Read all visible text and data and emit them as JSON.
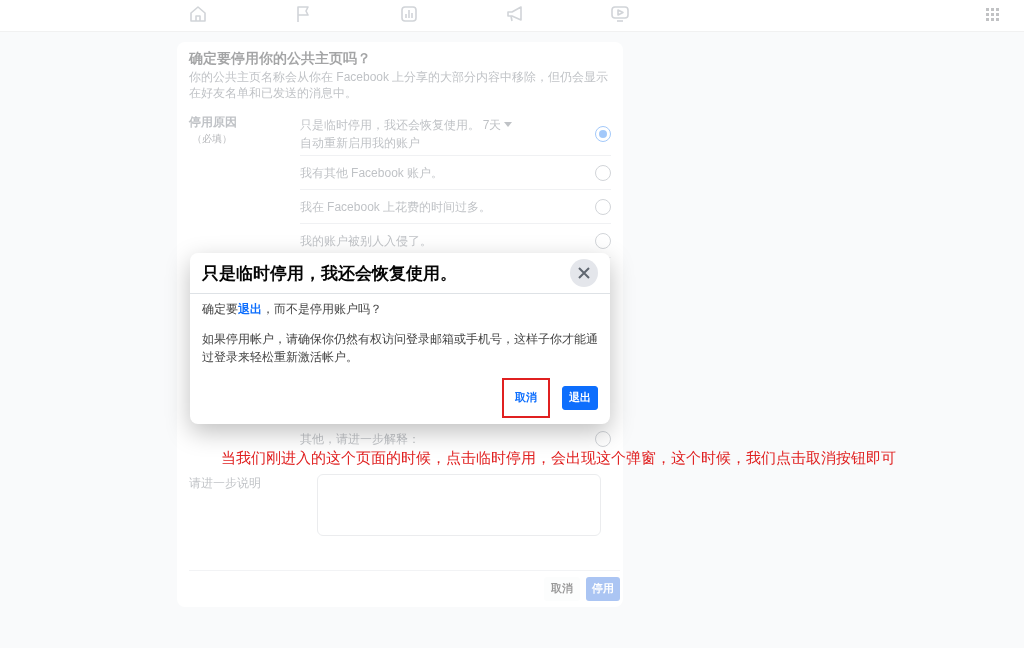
{
  "page": {
    "title": "确定要停用你的公共主页吗？",
    "description": "你的公共主页名称会从你在 Facebook 上分享的大部分内容中移除，但仍会显示在好友名单和已发送的消息中。",
    "reason_label": "停用原因",
    "reason_hint": "（必填）",
    "reasons": [
      {
        "label": "只是临时停用，我还会恢复使用。",
        "duration": "7天",
        "suffix": "自动重新启用我的账户",
        "selected": true
      },
      {
        "label": "我有其他 Facebook 账户。",
        "selected": false
      },
      {
        "label": "我在 Facebook 上花费的时间过多。",
        "selected": false
      },
      {
        "label": "我的账户被别人入侵了。",
        "selected": false
      },
      {
        "label": "其他，请进一步解释：",
        "selected": false
      }
    ],
    "explain_label": "请进一步说明",
    "buttons": [
      {
        "label": "取消",
        "kind": "secondary",
        "disabled": false
      },
      {
        "label": "停用",
        "kind": "primary",
        "disabled": true
      }
    ]
  },
  "dialog": {
    "title": "只是临时停用，我还会恢复使用。",
    "question": {
      "prefix": "确定要",
      "link": "退出",
      "suffix": "，而不是停用账户吗？"
    },
    "note": "如果停用帐户，请确保你仍然有权访问登录邮箱或手机号，这样子你才能通过登录来轻松重新激活帐户。",
    "buttons": [
      {
        "label": "取消",
        "kind": "text",
        "highlighted": true
      },
      {
        "label": "退出",
        "kind": "primary",
        "highlighted": false
      }
    ]
  },
  "annotation": "当我们刚进入的这个页面的时候，点击临时停用，会出现这个弹窗，这个时候，我们点击取消按钮即可"
}
